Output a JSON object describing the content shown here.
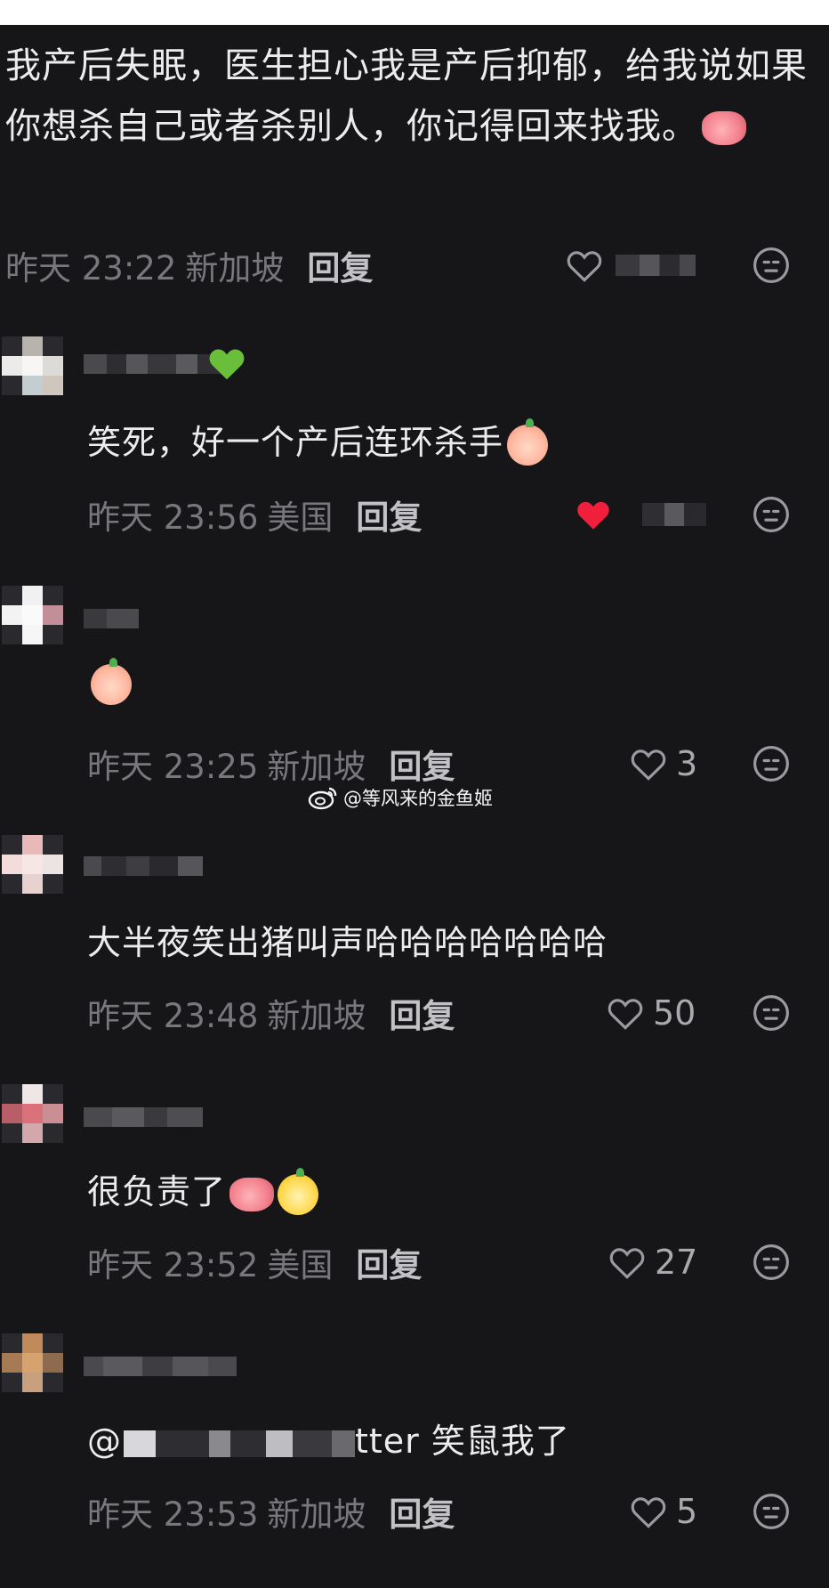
{
  "root_comment": {
    "text": "我产后失眠，医生担心我是产后抑郁，给我说如果你想杀自己或者杀别人，你记得回来找我。",
    "time": "昨天 23:22",
    "location": "新加坡",
    "reply_label": "回复",
    "like_count": "",
    "emoji": "thumbs-up-emoji"
  },
  "comments": [
    {
      "text": "笑死，好一个产后连环杀手",
      "time": "昨天 23:56",
      "location": "美国",
      "reply_label": "回复",
      "liked": true,
      "like_count": "",
      "emoji": "crying-laughing-peach-emoji"
    },
    {
      "text": "",
      "time": "昨天 23:25",
      "location": "新加坡",
      "reply_label": "回复",
      "liked": false,
      "like_count": "3",
      "emoji": "shy-peach-emoji"
    },
    {
      "text": "大半夜笑出猪叫声哈哈哈哈哈哈哈",
      "time": "昨天 23:48",
      "location": "新加坡",
      "reply_label": "回复",
      "liked": false,
      "like_count": "50",
      "emoji": ""
    },
    {
      "text": "很负责了",
      "time": "昨天 23:52",
      "location": "美国",
      "reply_label": "回复",
      "liked": false,
      "like_count": "27",
      "emoji": "thumbs-up-and-yellow-peach-emoji"
    },
    {
      "text_suffix": "tter  笑鼠我了",
      "mention_prefix": "@",
      "time": "昨天 23:53",
      "location": "新加坡",
      "reply_label": "回复",
      "liked": false,
      "like_count": "5",
      "emoji": ""
    }
  ],
  "watermark": {
    "text": "@等风来的金鱼姬",
    "icon": "weibo-icon"
  },
  "colors": {
    "background": "#161619",
    "liked_heart": "#f0203c",
    "meta_text": "#77777d"
  }
}
